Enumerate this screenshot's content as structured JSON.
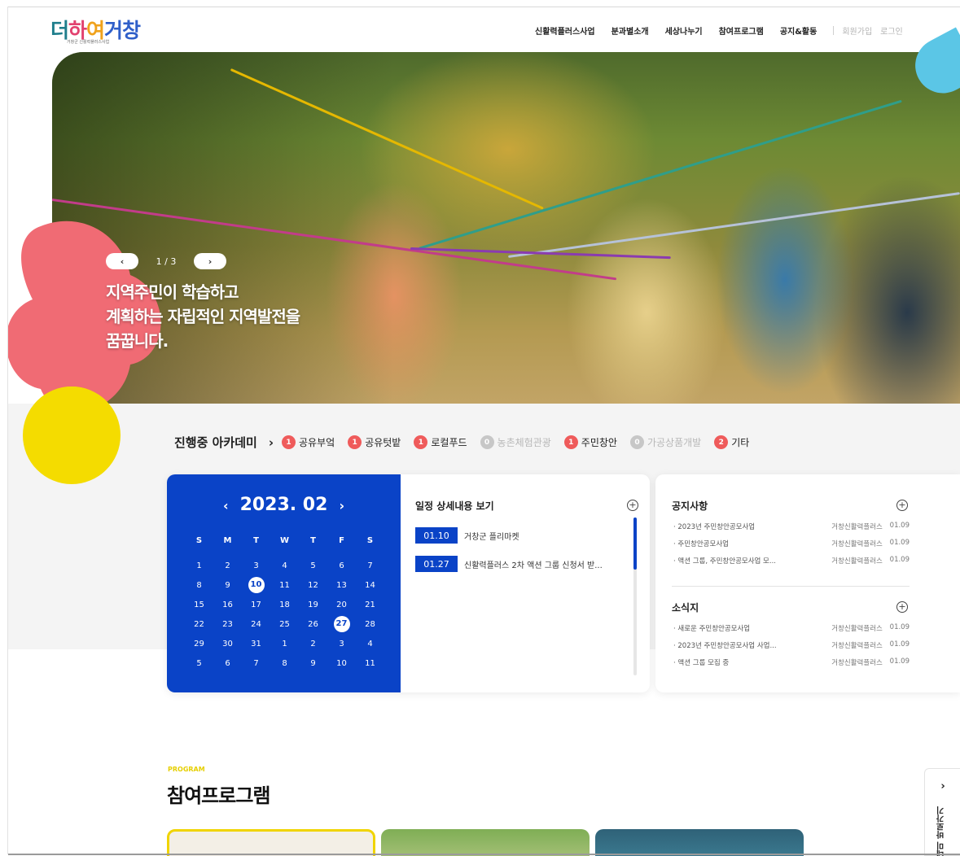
{
  "header": {
    "logo": {
      "part1": "더",
      "part2": "하",
      "part3": "여",
      "part4": "거창",
      "subtitle": "거창군 신활력플러스사업"
    },
    "nav": [
      "신활력플러스사업",
      "분과별소개",
      "세상나누기",
      "참여프로그램",
      "공지&활동"
    ],
    "auth": {
      "signup": "회원가입",
      "login": "로그인"
    }
  },
  "hero": {
    "prev_icon": "chevron-left-icon",
    "next_icon": "chevron-right-icon",
    "prev_glyph": "‹",
    "next_glyph": "›",
    "slide_counter": "1 / 3",
    "headline_line1": "지역주민이 학습하고",
    "headline_line2": "계획하는 자립적인 지역발전을",
    "headline_line3": "꿈꿉니다."
  },
  "academy": {
    "title": "진행중 아카데미",
    "chevron": "›",
    "items": [
      {
        "count": "1",
        "label": "공유부엌",
        "active": true
      },
      {
        "count": "1",
        "label": "공유텃밭",
        "active": true
      },
      {
        "count": "1",
        "label": "로컬푸드",
        "active": true
      },
      {
        "count": "0",
        "label": "농촌체험관광",
        "active": false
      },
      {
        "count": "1",
        "label": "주민창안",
        "active": true
      },
      {
        "count": "0",
        "label": "가공상품개발",
        "active": false
      },
      {
        "count": "2",
        "label": "기타",
        "active": true
      }
    ]
  },
  "calendar": {
    "prev": "‹",
    "next": "›",
    "month_label": "2023. 02",
    "days_of_week": [
      "S",
      "M",
      "T",
      "W",
      "T",
      "F",
      "S"
    ],
    "weeks": [
      [
        "1",
        "2",
        "3",
        "4",
        "5",
        "6",
        "7"
      ],
      [
        "8",
        "9",
        "10",
        "11",
        "12",
        "13",
        "14"
      ],
      [
        "15",
        "16",
        "17",
        "18",
        "19",
        "20",
        "21"
      ],
      [
        "22",
        "23",
        "24",
        "25",
        "26",
        "27",
        "28"
      ],
      [
        "29",
        "30",
        "31",
        "1",
        "2",
        "3",
        "4"
      ],
      [
        "5",
        "6",
        "7",
        "8",
        "9",
        "10",
        "11"
      ]
    ],
    "marked_days": [
      "10",
      "27"
    ]
  },
  "schedule": {
    "title": "일정 상세내용 보기",
    "more": "+",
    "items": [
      {
        "date": "01.10",
        "text": "거창군 플리마켓"
      },
      {
        "date": "01.27",
        "text": "신활력플러스 2차 액션 그룹 신청서 받..."
      }
    ]
  },
  "notices": {
    "title": "공지사항",
    "more": "+",
    "items": [
      {
        "title": "· 2023년 주민창안공모사업",
        "source": "거창신활력플러스",
        "date": "01.09"
      },
      {
        "title": "· 주민창안공모사업",
        "source": "거창신활력플러스",
        "date": "01.09"
      },
      {
        "title": "· 액션 그룹, 주민창안공모사업 모...",
        "source": "거창신활력플러스",
        "date": "01.09"
      }
    ]
  },
  "news": {
    "title": "소식지",
    "more": "+",
    "items": [
      {
        "title": "· 새로운 주민창안공모사업",
        "source": "거창신활력플러스",
        "date": "01.09"
      },
      {
        "title": "· 2023년 주민창안공모사업 사업...",
        "source": "거창신활력플러스",
        "date": "01.09"
      },
      {
        "title": "· 액션 그룹 모집 중",
        "source": "거창신활력플러스",
        "date": "01.09"
      }
    ]
  },
  "program": {
    "label": "PROGRAM",
    "title": "참여프로그램"
  },
  "side_tab": {
    "chevron": "›",
    "label": "아카데미 바로가기"
  },
  "colors": {
    "primary_blue": "#0a43c7",
    "badge_red": "#ef5b5b",
    "accent_yellow": "#f4dc00",
    "accent_pink": "#f06b74",
    "accent_sky": "#5bc6e6"
  }
}
